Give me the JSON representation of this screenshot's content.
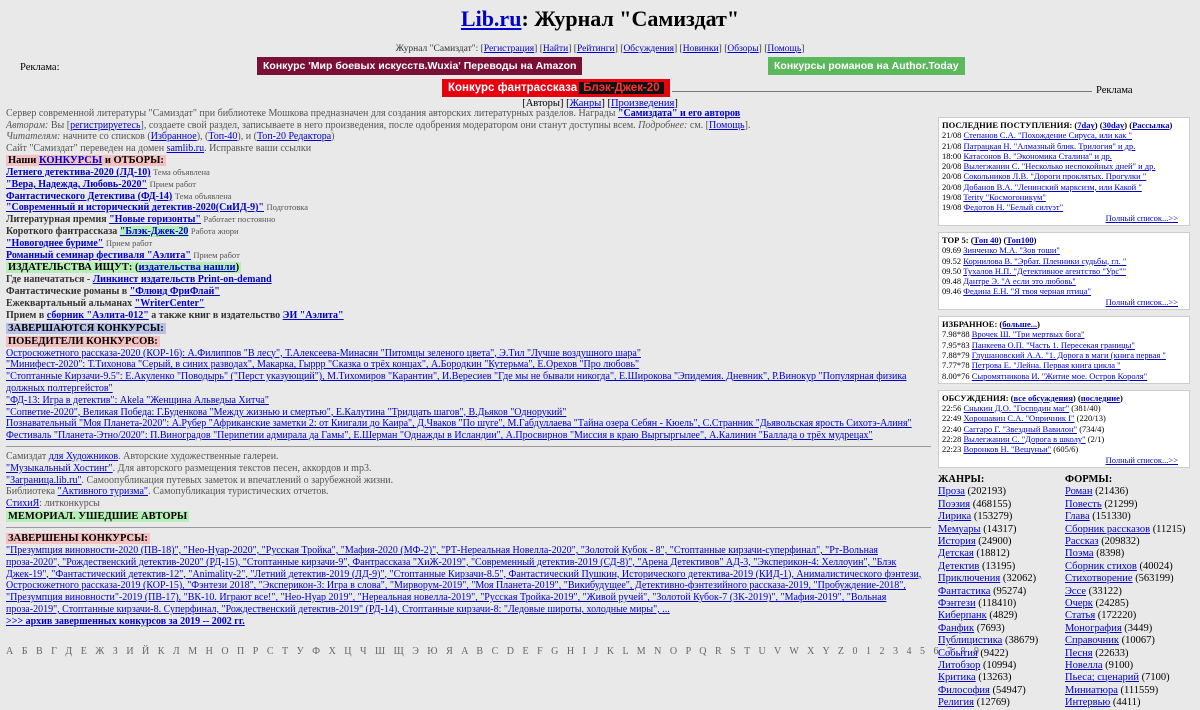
{
  "header": {
    "site": "Lib.ru",
    "title_rest": ": Журнал \"Самиздат\""
  },
  "topnav": {
    "prefix": "Журнал \"Самиздат\":",
    "links": [
      "Регистрация",
      "Найти",
      "Рейтинги",
      "Обсуждения",
      "Новинки",
      "Обзоры",
      "Помощь"
    ]
  },
  "ads": {
    "label_left": "Реклама:",
    "ad1": "Конкурс 'Мир боевых искусств.Wuxia' Переводы на Amazon",
    "ad2": "Конкурсы романов на Author.Today",
    "ad3_a": "Конкурс фантрассказа",
    "ad3_b": "Блэк-Джек-20",
    "label_right": "Реклама"
  },
  "subnav": {
    "items": [
      "Авторы",
      "Жанры",
      "Произведения"
    ]
  },
  "intro": {
    "l1_text": "Сервер современной литературы \"Самиздат\" при библиотеке Мошкова предназначен для создания авторских литературных разделов. Награды",
    "l1_link": "\"Самиздата\" и его авторов",
    "l2_a": "Авторам:",
    "l2_b": " Вы [",
    "l2_link": "регистрируетесь",
    "l2_c": "], создаете свой раздел, записываете в него произведения, после одобрения модератором они станут доступны всем.",
    "l2_d": " Подробнее:",
    "l2_e": " см. [",
    "l2_link2": "Помощь",
    "l2_f": "].",
    "l3_a": "Читателям:",
    "l3_b": " начните со списков (",
    "l3_l1": "Избранное",
    "l3_c": "), (",
    "l3_l2": "Топ-40",
    "l3_d": "), и (",
    "l3_l3": "Топ-20 Редактора",
    "l3_e": ")",
    "l4_a": "Сайт \"Самиздат\" переведен на домен ",
    "l4_link": "samlib.ru",
    "l4_b": ". Исправьте ваши ссылки"
  },
  "contests": {
    "head_a": "Наши ",
    "head_link": "КОНКУРСЫ",
    "head_b": " и ОТБОРЫ:",
    "items": [
      {
        "link": "Летнего детектива-2020 (ЛД-10)",
        "note": "Тема объявлена"
      },
      {
        "link": "\"Вера, Надежда, Любовь-2020\"",
        "note": "Прием работ"
      },
      {
        "link": "Фантастического Детектива (ФД-14)",
        "note": "Тема объявлена"
      },
      {
        "link": "\"Современный и исторический детектив-2020(СиИД-9)\"",
        "note": "Подготовка"
      }
    ],
    "extra": [
      {
        "pre": "Литературная премия ",
        "link": "\"Новые горизонты\"",
        "note": "Работает постоянно"
      },
      {
        "pre": "Короткого фантрассказа ",
        "link": "\"Блэк-Джек-20",
        "note": "Работа жюри"
      },
      {
        "pre": "",
        "link": "\"Новогоднее буриме\"",
        "note": "Прием работ"
      },
      {
        "pre": "",
        "link": "Романный семинар фестиваля \"Аэлита\"",
        "note": "Прием работ"
      }
    ]
  },
  "publish": {
    "head_a": "ИЗДАТЕЛЬСТВА ИЩУТ: (",
    "head_link": "издательства нашли",
    "head_b": ")",
    "rows": [
      {
        "pre": "Где напечататься - ",
        "link": "Линкинст издательств Print-on-demand"
      },
      {
        "pre": "Фантастические романы в ",
        "link": "\"Флюид ФриФлай\""
      },
      {
        "pre": "Ежеквартальный альманах ",
        "link": "\"WriterCenter\""
      },
      {
        "pre": "Прием в ",
        "link": "сборник \"Аэлита-012\"",
        "mid": " а также книг в издательство ",
        "link2": "ЭИ \"Аэлита\""
      }
    ]
  },
  "ending": {
    "head": "ЗАВЕРШАЮТСЯ КОНКУРСЫ:"
  },
  "winners": {
    "head": "ПОБЕДИТЕЛИ КОНКУРСОВ:",
    "rows": [
      "Остросюжетного рассказа-2020 (КОР-16): А.Филиппов \"В лесу\", Т.Алексеева-Минасян \"Питомцы зеленого цвета\", Э.Тил \"Лучше воздушного шара\"",
      "\"Минифест-2020\": Т.Тихонова \"Серый, в синих разводах\", Макарка, Гыррр \"Сказка о трёх концах\", А.Бородкин \"Кутерьма\", Е.Орехов \"Про любовь\"",
      "\"Стоптанные Кирзачи-9.5\": Е.Акуленко \"Поводырь\" (\"Перст указующий\"), М.Тихомиров \"Карантин\", И.Вересиев \"Где мы не бывали никогда\", Е.Широкова \"Эпидемия. Дневник\", Р.Винокур \"Популярная физика должных полтергейстов\"",
      "\"ФД-13: Игра в детектив\": Akela \"Женщина Альведыа Хитча\"",
      "\"Сопветие-2020\", Великая Победа: Г.Буденкова \"Между жизнью и смертью\", Е.Калутина \"Тридцать шагов\", В.Дьяков \"Однорукий\"",
      "Познавательный \"Моя Планета-2020\": А.Рубер \"Африканские заметки 2: от Киигали до Каира\", Д.Чваков \"По шуге\", М.Габдуллаева \"Тайна озера Себян - Кюель\", С.Странник \"Дьявольская ярость Сихотэ-Алиня\"",
      "Фестиваль \"Планета-Этно/2020\": П.Виноградов \"Перипетии адмирала да Гамы\", Е.Шерман \"Однажды в Исландии\", А.Просвирнов \"Миссия в краю Выргыргылее\", А.Калинин \"Баллада о трёх мудрецах\""
    ]
  },
  "misc": {
    "rows": [
      {
        "a": "Самиздат ",
        "link": "для Художников",
        "b": ". Авторские художественные галереи."
      },
      {
        "a": "",
        "link": "\"Музыкальный Хостинг\"",
        "b": ". Для авторского размещения текстов песен, аккордов и mp3."
      },
      {
        "a": "",
        "link": "\"Заграница.lib.ru\"",
        "b": ". Самоопубликация путевых заметок и впечатлений о зарубежной жизни."
      },
      {
        "a": "Библиотека ",
        "link": "\"Активного туризма\"",
        "b": ". Самопубликация туристических отчетов."
      },
      {
        "a": "",
        "link": "СтихиЯ",
        "b": ": литконкурсы"
      }
    ],
    "memorial": "МЕМОРИАЛ. УШЕДШИЕ АВТОРЫ"
  },
  "finished": {
    "head": "ЗАВЕРШЕНЫ КОНКУРСЫ:",
    "text": "\"Презумпция виновности-2020 (ПВ-18)\", \"Нео-Нуар-2020\", \"Русская Тройка\", \"Мафия-2020 (МФ-2)\", \"РТ-Нереальная Новелла-2020\", \"Золотой Кубок - 8\", \"Стоптанные кирзачи-суперфинал\", \"Рт-Вольная проза-2020\", \"Рождественский детектив-2020\" (РД-15), \"Стоптанные кирзачи-9\", Фантрассказа \"ХиЖ-2019\", \"Современный детектив-2019 (СД-8)\", \"Арена Детективов\" АД-3, \"Эксперикон-4: Хеллоуин\", \"Блэк Джек-19\", \"Фантастический детектив-12\", \"Animality-2\", \"Летний детектив-2019 (ЛД-9)\", \"Стоптанные Кирзачи-8.5\", Фантастический Пушкин, Исторического детектива-2019 (КИД-1), Анималистического фэнтези, Остросюжетного рассказа-2019 (КОР-15), \"Фэнтези 2018\", \"Эксперикон-3: Игра в слова\", \"Мирворум-2019\", \"Моя Планета-2019\", \"Викибудущее\", Детективно-фэнтезийного рассказа-2019, \"Пробуждение-2018\", \"Презумпция виновности\"-2019 (ПВ-17), \"ВК-10. Играют все!\", \"Нео-Нуар 2019\", \"Нереальная новелла-2019\", \"Русская Тройка-2019\", \"Живой ручей\", \"Золотой Кубок-7 (ЗК-2019)\", \"Мафия-2019\", \"Вольная проза-2019\", Стоптанные кирзачи-8. Суперфинал, \"Рождественский детектив-2019\" (РД-14), Стоптанные кирзачи-8: \"Ледовые широты, холодные миры\", ...",
    "archive": ">>> архив завершенных конкурсов за 2019 -- 2002 гг."
  },
  "alpha": "А Б В Г Д Е Ж З И Й К Л М Н О П Р С Т У Ф Х Ц Ч Ш Щ Э Ю Я A B C D E F G H I J K L M N O P Q R S T U V W X Y Z 0 1 2 3 4 5 6 7 8 9",
  "right": {
    "latest": {
      "head": "ПОСЛЕДНИЕ ПОСТУПЛЕНИЯ: (",
      "l7": "7day",
      "l30": "30day",
      "lr": "Рассылка",
      "rows": [
        {
          "d": "21/08 ",
          "t": "Степанов С.А. \"Похождение Сируса, или как \""
        },
        {
          "d": "21/08 ",
          "t": "Патрацкая Н. \"Алмазный блик. Трилогия\" и др."
        },
        {
          "d": "18:00 ",
          "t": "Катасонов В. \"Экономика Сталина\" и др."
        },
        {
          "d": "20/08 ",
          "t": "Вылегжанин С. \"Несколько неспокойных дней\" и др."
        },
        {
          "d": "20/08 ",
          "t": "Сокольников Л.В. \"Дороги проклятых. Прогулки \""
        },
        {
          "d": "20/08 ",
          "t": "Добанов В.А. \"Ленинский марксизм, или Какой \""
        },
        {
          "d": "19/08 ",
          "t": "Terity \"Космогоникум\""
        },
        {
          "d": "19/08 ",
          "t": "Федотов Н. \"Белый силуэт\""
        }
      ],
      "more": "Полный список...>>"
    },
    "top5": {
      "head": "ТОР 5: (",
      "l40": "Топ 40",
      "l100": "Топ100",
      "rows": [
        {
          "d": "09.69 ",
          "t": "Зинченко М.А. \"Зов тоши\""
        },
        {
          "d": "09.52 ",
          "t": "Корнилова В. \"Эрбат. Пленники судьбы, гл. \""
        },
        {
          "d": "09.50 ",
          "t": "Тухалов Н.П. \"Детективное агентство \"Урс\"\""
        },
        {
          "d": "09.48 ",
          "t": "Дантре Э. \"А если это любовь\""
        },
        {
          "d": "09.46 ",
          "t": "Федина Е.Н. \"Я твоя черная птица\""
        }
      ],
      "more": "Полный список...>>"
    },
    "fav": {
      "head": "ИЗБРАННОЕ: (",
      "link": "больше...",
      "rows": [
        {
          "d": "7.98*88 ",
          "t": "Врочек Ш. \"Три мертвых бога\""
        },
        {
          "d": "7.95*83 ",
          "t": "Панкеева О.П. \"Часть 1. Пересекая границы\""
        },
        {
          "d": "7.88*79 ",
          "t": "Глушановский А.А. \"1. Дорога в маги (книга первая \""
        },
        {
          "d": "7.77*78 ",
          "t": "Петрова Е. \"Лейна. Первая книга цикла \""
        },
        {
          "d": "8.00*76 ",
          "t": "Сыромятникова И. \"Житие мое. Остров Короля\""
        }
      ],
      "more": "Полный список...>>"
    },
    "disc": {
      "head": "ОБСУЖДЕНИЯ: (",
      "l1": "все обсуждения",
      "l2": "последние",
      "rows": [
        {
          "d": "22:56 ",
          "t": "Сныкин Д.О. \"Господин маг\"",
          "n": " (381/40)"
        },
        {
          "d": "22:49 ",
          "t": "Хорошавин С.А. \"Опричник I\"",
          "n": " (220/13)"
        },
        {
          "d": "22:40 ",
          "t": "Саггаро Г. \"Звездный Вавилон\"",
          "n": " (734/4)"
        },
        {
          "d": "22:28 ",
          "t": "Вылегжанин С. \"Дорога в школу\"",
          "n": " (2/1)"
        },
        {
          "d": "22:23 ",
          "t": "Воронков Н. \"Вещуньи\"",
          "n": " (605/6)"
        }
      ],
      "more": "Полный список...>>"
    },
    "genres": {
      "head": "ЖАНРЫ:",
      "rows": [
        {
          "n": "Проза",
          "c": " (202193)"
        },
        {
          "n": "Поэзия",
          "c": " (468155)"
        },
        {
          "n": "Лирика",
          "c": " (153279)"
        },
        {
          "n": "Мемуары",
          "c": " (14317)"
        },
        {
          "n": "История",
          "c": " (24900)"
        },
        {
          "n": "Детская",
          "c": " (18812)"
        },
        {
          "n": "Детектив",
          "c": " (13195)"
        },
        {
          "n": "Приключения",
          "c": " (32062)"
        },
        {
          "n": "Фантастика",
          "c": " (95274)"
        },
        {
          "n": "Фэнтези",
          "c": " (118410)"
        },
        {
          "n": "Киберпанк",
          "c": " (4829)"
        },
        {
          "n": "Фанфик",
          "c": " (7693)"
        },
        {
          "n": "Публицистика",
          "c": " (38679)"
        },
        {
          "n": "События",
          "c": " (9422)"
        },
        {
          "n": "Литобзор",
          "c": " (10994)"
        },
        {
          "n": "Критика",
          "c": " (13263)"
        },
        {
          "n": "Философия",
          "c": " (54947)"
        },
        {
          "n": "Религия",
          "c": " (12769)"
        }
      ]
    },
    "forms": {
      "head": "ФОРМЫ:",
      "rows": [
        {
          "n": "Роман",
          "c": " (21436)"
        },
        {
          "n": "Повесть",
          "c": " (21299)"
        },
        {
          "n": "Глава",
          "c": " (151330)"
        },
        {
          "n": "Сборник рассказов",
          "c": " (11215)"
        },
        {
          "n": "Рассказ",
          "c": " (209832)"
        },
        {
          "n": "Поэма",
          "c": " (8398)"
        },
        {
          "n": "Сборник стихов",
          "c": " (40024)"
        },
        {
          "n": "Стихотворение",
          "c": " (563199)"
        },
        {
          "n": "Эссе",
          "c": " (33122)"
        },
        {
          "n": "Очерк",
          "c": " (24285)"
        },
        {
          "n": "Статья",
          "c": " (172220)"
        },
        {
          "n": "Монография",
          "c": " (3449)"
        },
        {
          "n": "Справочник",
          "c": " (10067)"
        },
        {
          "n": "Песня",
          "c": " (22633)"
        },
        {
          "n": "Новелла",
          "c": " (9100)"
        },
        {
          "n": "Пьеса; сценарий",
          "c": " (7100)"
        },
        {
          "n": "Миниатюра",
          "c": " (111559)"
        },
        {
          "n": "Интервью",
          "c": " (4411)"
        }
      ]
    }
  }
}
